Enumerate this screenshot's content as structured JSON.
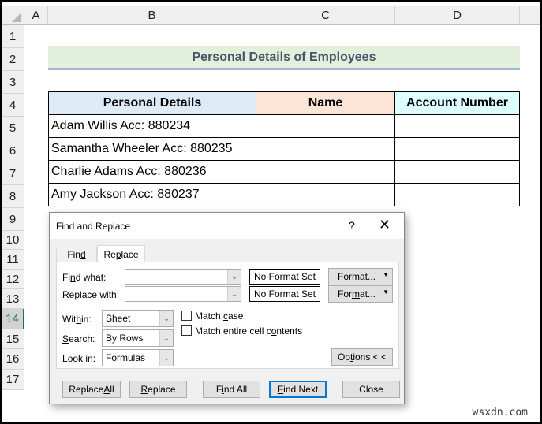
{
  "sheet": {
    "columns": [
      "A",
      "B",
      "C",
      "D"
    ],
    "rows": [
      "1",
      "2",
      "3",
      "4",
      "5",
      "6",
      "7",
      "8",
      "9",
      "10",
      "11",
      "12",
      "13",
      "14",
      "15",
      "16",
      "17"
    ],
    "selected_row": "14",
    "title": "Personal Details of Employees",
    "table": {
      "headers": [
        "Personal Details",
        "Name",
        "Account Number"
      ],
      "rows": [
        [
          "Adam Willis Acc: 880234",
          "",
          ""
        ],
        [
          "Samantha Wheeler Acc: 880235",
          "",
          ""
        ],
        [
          "Charlie Adams Acc: 880236",
          "",
          ""
        ],
        [
          "Amy Jackson Acc: 880237",
          "",
          ""
        ]
      ]
    },
    "colors": {
      "title_bg": "#e2efda",
      "title_text": "#44546a",
      "header_personal": "#ddebf7",
      "header_name": "#fce4d6",
      "header_account": "#ddffff"
    }
  },
  "dialog": {
    "title": "Find and Replace",
    "help": "?",
    "close": "✕",
    "tabs": [
      {
        "pre": "Fin",
        "u": "d",
        "post": ""
      },
      {
        "pre": "Re",
        "u": "p",
        "post": "lace"
      }
    ],
    "find_what": {
      "pre": "Fi",
      "u": "n",
      "post": "d what:",
      "value": ""
    },
    "replace_with": {
      "pre": "R",
      "u": "e",
      "post": "place with:",
      "value": ""
    },
    "no_format": "No Format Set",
    "format_btn": {
      "pre": "For",
      "u": "m",
      "post": "at..."
    },
    "within": {
      "pre": "Wit",
      "u": "h",
      "post": "in:",
      "value": "Sheet"
    },
    "search": {
      "pre": "",
      "u": "S",
      "post": "earch:",
      "value": "By Rows"
    },
    "look_in": {
      "pre": "",
      "u": "L",
      "post": "ook in:",
      "value": "Formulas"
    },
    "match_case": {
      "pre": "Match ",
      "u": "c",
      "post": "ase",
      "checked": false
    },
    "match_entire": {
      "pre": "Match entire cell c",
      "u": "o",
      "post": "ntents",
      "checked": false
    },
    "options_btn": {
      "pre": "Op",
      "u": "t",
      "post": "ions < <"
    },
    "buttons": {
      "replace_all": {
        "pre": "Replace ",
        "u": "A",
        "post": "ll"
      },
      "replace": {
        "pre": "",
        "u": "R",
        "post": "eplace"
      },
      "find_all": {
        "pre": "F",
        "u": "i",
        "post": "nd All"
      },
      "find_next": {
        "pre": "",
        "u": "F",
        "post": "ind Next"
      },
      "close": {
        "pre": "Close",
        "u": "",
        "post": ""
      }
    }
  },
  "watermark": "wsxdn.com"
}
